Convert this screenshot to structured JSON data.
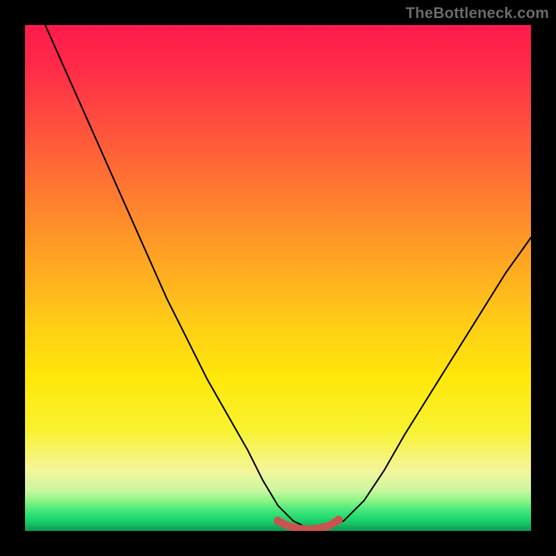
{
  "watermark": {
    "text": "TheBottleneck.com"
  },
  "colors": {
    "frame": "#000000",
    "curve_stroke": "#000000",
    "marker_stroke": "#c9534f",
    "marker_fill": "#c9534f"
  },
  "chart_data": {
    "type": "line",
    "title": "",
    "xlabel": "",
    "ylabel": "",
    "xlim": [
      0,
      100
    ],
    "ylim": [
      0,
      100
    ],
    "grid": false,
    "legend": false,
    "series": [
      {
        "name": "bottleneck-curve",
        "x": [
          4,
          8,
          12,
          16,
          20,
          24,
          28,
          32,
          36,
          40,
          44,
          47,
          50,
          53,
          56,
          58,
          60,
          63,
          67,
          71,
          75,
          80,
          85,
          90,
          95,
          100
        ],
        "y": [
          100,
          91,
          82,
          73,
          64,
          55,
          46,
          38,
          30,
          23,
          16,
          10,
          5,
          2,
          0.5,
          0.2,
          0.5,
          2,
          6,
          12,
          19,
          27,
          35,
          43,
          51,
          58
        ]
      },
      {
        "name": "optimal-range-marker",
        "x": [
          50,
          52,
          54,
          56,
          58,
          60,
          62
        ],
        "y": [
          2.0,
          1.0,
          0.5,
          0.3,
          0.5,
          1.0,
          2.2
        ]
      }
    ],
    "annotations": []
  }
}
